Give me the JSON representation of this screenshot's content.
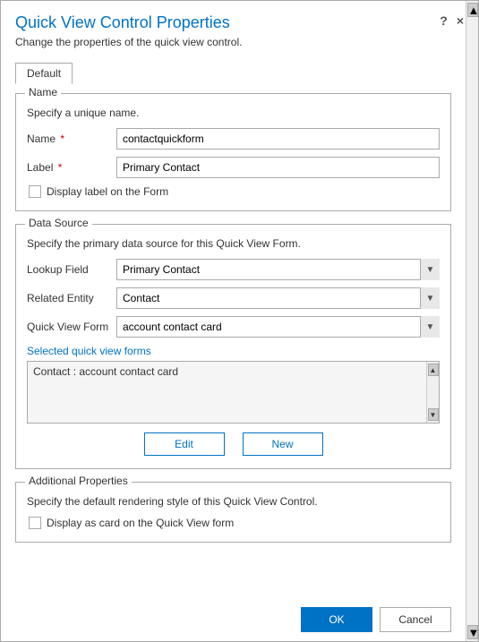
{
  "dialog": {
    "title": "Quick View Control Properties",
    "subtitle": "Change the properties of the quick view control.",
    "help_icon": "?",
    "close_icon": "×"
  },
  "tabs": [
    {
      "label": "Default",
      "active": true
    }
  ],
  "name_section": {
    "legend": "Name",
    "description": "Specify a unique name.",
    "name_label": "Name",
    "name_required": true,
    "name_value": "contactquickform",
    "label_label": "Label",
    "label_required": true,
    "label_value": "Primary Contact",
    "checkbox_label": "Display label on the Form"
  },
  "datasource_section": {
    "legend": "Data Source",
    "description": "Specify the primary data source for this Quick View Form.",
    "lookup_label": "Lookup Field",
    "lookup_options": [
      "Primary Contact"
    ],
    "lookup_selected": "Primary Contact",
    "entity_label": "Related Entity",
    "entity_options": [
      "Contact"
    ],
    "entity_selected": "Contact",
    "form_label": "Quick View Form",
    "form_options": [
      "account contact card"
    ],
    "form_selected": "account contact card",
    "selected_forms_label": "Selected quick view forms",
    "selected_forms_item": "Contact : account contact card",
    "edit_button": "Edit",
    "new_button": "New"
  },
  "additional_section": {
    "legend": "Additional Properties",
    "description": "Specify the default rendering style of this Quick View Control.",
    "checkbox_label": "Display as card on the Quick View form"
  },
  "footer": {
    "ok_label": "OK",
    "cancel_label": "Cancel"
  }
}
